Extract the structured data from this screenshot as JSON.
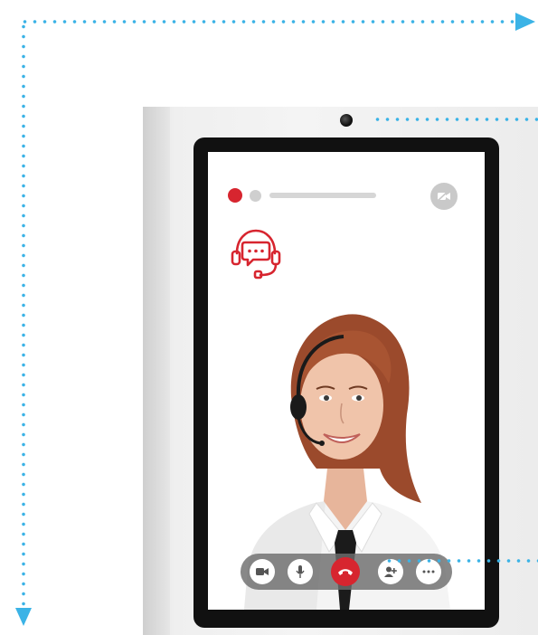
{
  "guides": {
    "color": "#3bb3e6"
  },
  "kiosk": {
    "body_color": "#f2f2f2",
    "screen": {
      "status_dots": [
        {
          "icon": "active-step-dot",
          "color": "#d7252f"
        },
        {
          "icon": "pending-step-dot",
          "color": "#cfcfcf"
        }
      ],
      "progress_track_color": "#d6d6d6",
      "camera_toggle_icon": "camera-off-icon",
      "support_icon": "headset-chat-icon",
      "accent_color": "#d7252f",
      "operator_image": "operator-with-headset",
      "call_controls": [
        {
          "name": "video-button",
          "icon": "video-camera-icon"
        },
        {
          "name": "mute-button",
          "icon": "microphone-icon"
        },
        {
          "name": "end-call-button",
          "icon": "hang-up-icon",
          "color": "#d7252f"
        },
        {
          "name": "add-participant-button",
          "icon": "add-user-icon"
        },
        {
          "name": "more-options-button",
          "icon": "ellipsis-icon"
        }
      ]
    }
  }
}
